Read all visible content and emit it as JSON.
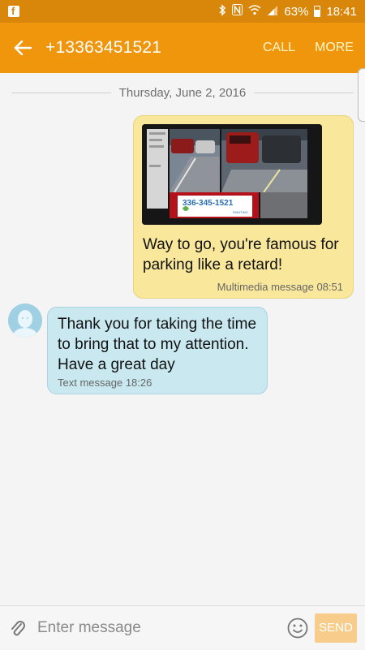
{
  "status_bar": {
    "notification_icon": "facebook-icon",
    "battery_percent": "63%",
    "time": "18:41",
    "icons": [
      "bluetooth-icon",
      "nfc-icon",
      "wifi-icon",
      "signal-icon",
      "battery-icon"
    ]
  },
  "app_bar": {
    "back_icon": "back-arrow-icon",
    "title": "+13363451521",
    "call_label": "CALL",
    "more_label": "MORE"
  },
  "thread": {
    "date_divider": "Thursday, June 2, 2016",
    "messages": [
      {
        "direction": "outgoing",
        "has_image": true,
        "image_caption": "336-345-1521",
        "image_caption_sub": "PAINTING",
        "text": "Way to go, you're famous for parking like a retard!",
        "meta": "Multimedia message 08:51"
      },
      {
        "direction": "incoming",
        "text": "Thank you for taking the time to bring that to my attention.  Have a great day",
        "meta": "Text message 18:26"
      }
    ]
  },
  "composer": {
    "attach_icon": "paperclip-icon",
    "placeholder": "Enter message",
    "value": "",
    "emoji_icon": "smiley-icon",
    "send_label": "SEND"
  },
  "colors": {
    "status_bar": "#d9870a",
    "app_bar": "#f0960d",
    "outgoing_bubble": "#f9e79b",
    "incoming_bubble": "#c9e8f0",
    "send_button": "#f8cc8a"
  }
}
